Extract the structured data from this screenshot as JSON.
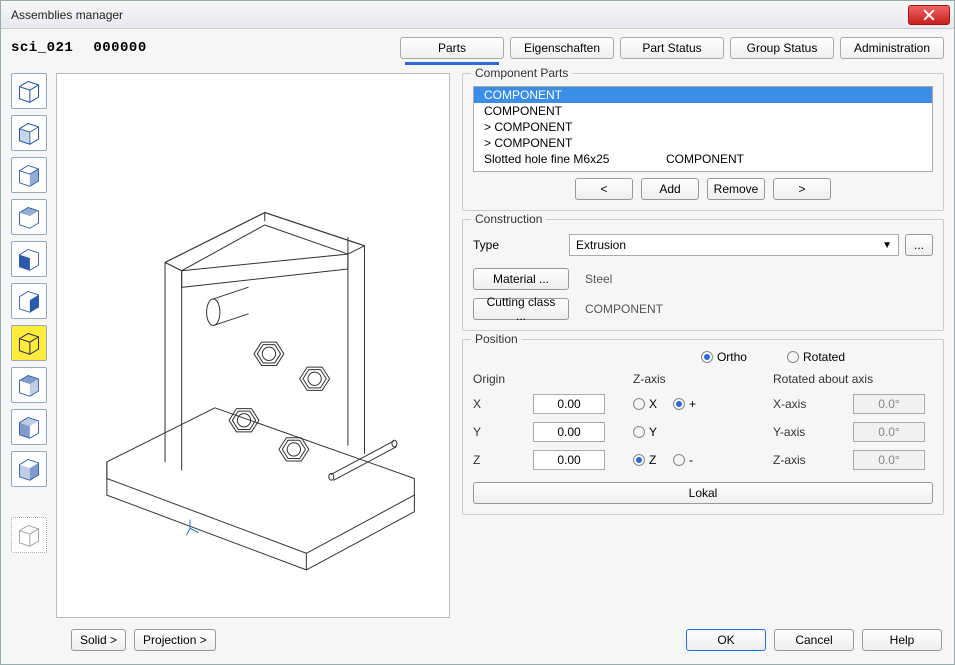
{
  "window": {
    "title": "Assemblies manager"
  },
  "idline": {
    "id": "sci_021",
    "rev": "000000"
  },
  "tabs": {
    "parts": "Parts",
    "props": "Eigenschaften",
    "part_status": "Part Status",
    "group_status": "Group Status",
    "admin": "Administration"
  },
  "component_parts": {
    "label": "Component Parts",
    "rows": [
      {
        "c1": "COMPONENT",
        "c2": "",
        "sel": true
      },
      {
        "c1": "COMPONENT",
        "c2": ""
      },
      {
        "c1": "> COMPONENT",
        "c2": ""
      },
      {
        "c1": "> COMPONENT",
        "c2": ""
      },
      {
        "c1": "Slotted hole fine M6x25",
        "c2": "COMPONENT"
      }
    ],
    "btn_prev": "<",
    "btn_add": "Add",
    "btn_remove": "Remove",
    "btn_next": ">"
  },
  "construction": {
    "label": "Construction",
    "type_label": "Type",
    "type_value": "Extrusion",
    "ellipsis": "...",
    "material_btn": "Material ...",
    "material_value": "Steel",
    "cutting_btn": "Cutting class ...",
    "cutting_value": "COMPONENT"
  },
  "position": {
    "label": "Position",
    "ortho": "Ortho",
    "rotated": "Rotated",
    "origin": "Origin",
    "zaxis": "Z-axis",
    "rotabout": "Rotated about axis",
    "x": "X",
    "y": "Y",
    "z": "Z",
    "xv": "0.00",
    "yv": "0.00",
    "zv": "0.00",
    "plus": "+",
    "minus": "-",
    "rx": "X-axis",
    "ry": "Y-axis",
    "rz": "Z-axis",
    "rv": "0.0°",
    "lokal": "Lokal"
  },
  "footer": {
    "solid": "Solid >",
    "projection": "Projection >",
    "ok": "OK",
    "cancel": "Cancel",
    "help": "Help"
  }
}
